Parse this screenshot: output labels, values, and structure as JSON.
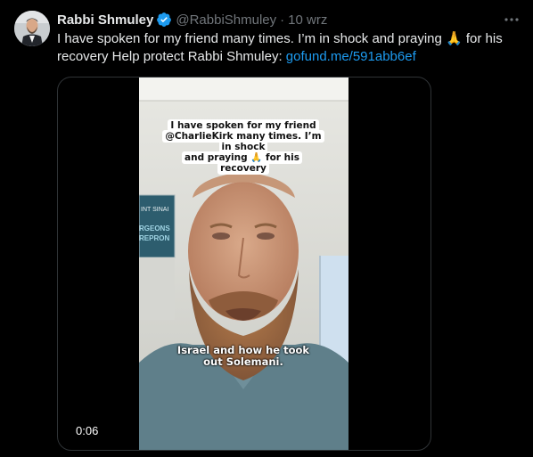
{
  "tweet": {
    "author": {
      "name": "Rabbi Shmuley",
      "handle": "@RabbiShmuley",
      "separator": "·",
      "date": "10 wrz",
      "verified": true,
      "avatar_icon": "avatar-photo"
    },
    "text": {
      "line1": "I have spoken for my friend many times. I’m in shock and praying 🙏 for his",
      "line2": "recovery Help protect Rabbi Shmuley: ",
      "link": "gofund.me/591abb6ef"
    },
    "more_icon": "more-horizontal-icon"
  },
  "video": {
    "caption_top": {
      "line1": "I have spoken for my friend",
      "line2": "@CharlieKirk many times. I’m in shock",
      "line3": "and praying 🙏 for his recovery"
    },
    "caption_bottom": {
      "line1": "Israel and how he took",
      "line2": "out Solemani."
    },
    "poster_texts": {
      "top": "INT SINAI",
      "bottom1": "RGEONS",
      "bottom2": "REPRON"
    },
    "time": "0:06"
  },
  "colors": {
    "background": "#000000",
    "text": "#e7e9ea",
    "muted": "#71767b",
    "link": "#1d9bf0",
    "verified": "#1d9bf0",
    "border": "#2f3336"
  }
}
